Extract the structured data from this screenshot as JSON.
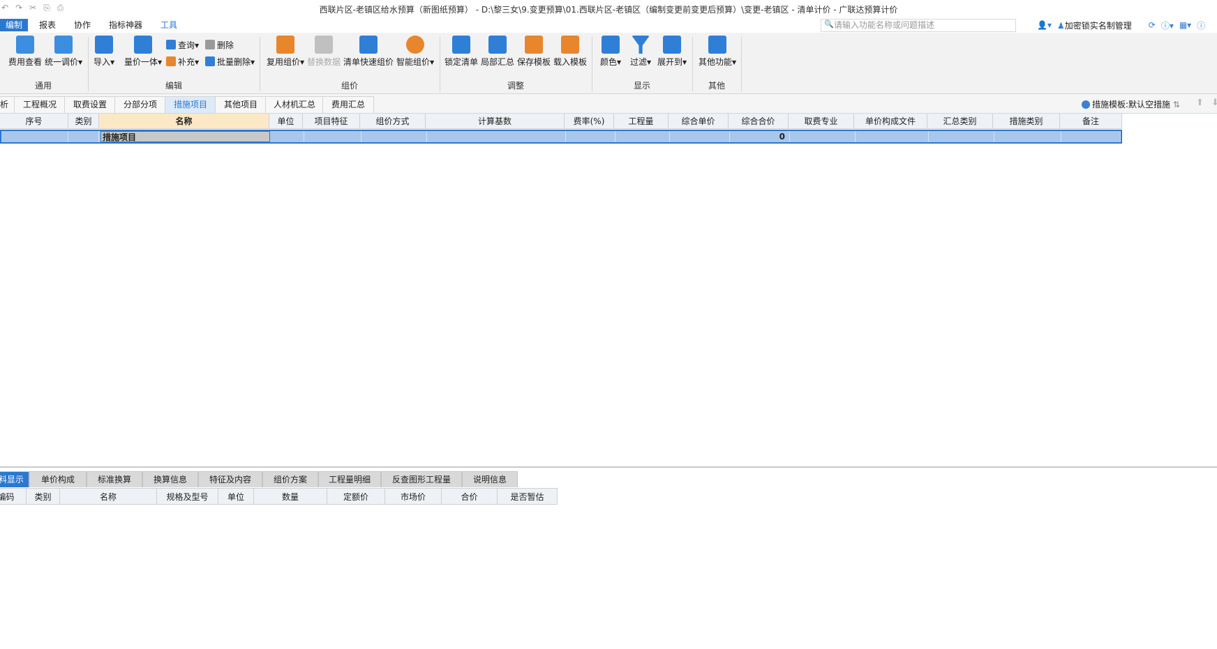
{
  "window": {
    "title": "西联片区-老镇区给水预算（新图纸预算）  - D:\\黎三女\\9.变更预算\\01.西联片区-老镇区（编制变更前变更后预算）\\变更-老镇区 - 清单计价 - 广联达预算计价",
    "quick_access": [
      "↶",
      "↷",
      "✂",
      "⎘",
      "⎙"
    ]
  },
  "menu": {
    "items": [
      "编制",
      "报表",
      "协作",
      "指标神器",
      "工具"
    ],
    "search_placeholder": "请输入功能名称或问题描述",
    "lock_manager": "加密锁实名制管理"
  },
  "ribbon": {
    "groups": {
      "general": "通用",
      "edit": "编辑",
      "pricing": "组价",
      "adjust": "调整",
      "display": "显示",
      "other": "其他"
    },
    "buttons": {
      "fee_view": "费用查看",
      "unify_price": "统一调价",
      "import": "导入",
      "qty_price": "量价一体",
      "query": "查询",
      "supplement": "补充",
      "delete": "删除",
      "batch_delete": "批量删除",
      "reuse_pricing": "复用组价",
      "replace_data": "替换数据",
      "quick_pricing": "清单快速组价",
      "smart_pricing": "智能组价",
      "lock_list": "锁定清单",
      "partial_summary": "局部汇总",
      "save_template": "保存模板",
      "load_template": "载入模板",
      "color": "颜色",
      "filter": "过滤",
      "expand_to": "展开到",
      "other_functions": "其他功能"
    }
  },
  "nav_tabs": [
    "析",
    "工程概况",
    "取费设置",
    "分部分项",
    "措施项目",
    "其他项目",
    "人材机汇总",
    "费用汇总"
  ],
  "template_info": "措施模板:默认空措施",
  "grid": {
    "columns": [
      "序号",
      "类别",
      "名称",
      "单位",
      "项目特征",
      "组价方式",
      "计算基数",
      "费率(%)",
      "工程量",
      "综合单价",
      "综合合价",
      "取费专业",
      "单价构成文件",
      "汇总类别",
      "措施类别",
      "备注"
    ],
    "rows": [
      {
        "name": "措施项目",
        "total": "0"
      }
    ]
  },
  "bottom_tabs": [
    "料显示",
    "单价构成",
    "标准换算",
    "换算信息",
    "特征及内容",
    "组价方案",
    "工程量明细",
    "反查图形工程量",
    "说明信息"
  ],
  "bottom_columns": [
    "编码",
    "类别",
    "名称",
    "规格及型号",
    "单位",
    "数量",
    "定额价",
    "市场价",
    "合价",
    "是否暂估"
  ],
  "colors": {
    "accent": "#2b78d0",
    "selected_row": "#a9c7ea",
    "header_bg": "#eef1f5",
    "selected_header": "#fde8c6"
  }
}
